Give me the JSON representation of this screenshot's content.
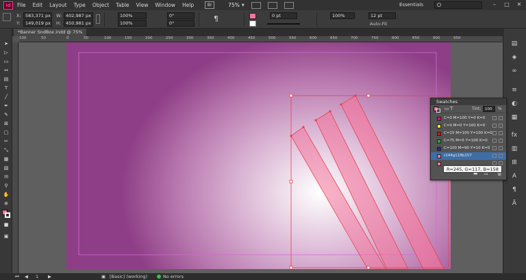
{
  "app": {
    "logo_text": "Id",
    "bridge_label": "Br",
    "zoom": "75%",
    "workspace": "Essentials"
  },
  "menu": [
    "File",
    "Edit",
    "Layout",
    "Type",
    "Object",
    "Table",
    "View",
    "Window",
    "Help"
  ],
  "control_panel": {
    "x_label": "X:",
    "x_value": "583,371 px",
    "y_label": "Y:",
    "y_value": "149,019 px",
    "w_label": "W:",
    "w_value": "402,987 px",
    "h_label": "H:",
    "h_value": "450,981 px",
    "scale_x": "100%",
    "scale_y": "100%",
    "rotate": "0°",
    "shear": "0°",
    "stroke_weight": "0 pt",
    "opacity": "100%",
    "font_size": "12 pt",
    "auto_fit": "Auto-Fit"
  },
  "document": {
    "tab_title": "*Banner SndBox.indd @ 75%"
  },
  "ruler": {
    "ticks": [
      "100",
      "50",
      "0",
      "50",
      "100",
      "150",
      "200",
      "250",
      "300",
      "350",
      "400",
      "450",
      "500",
      "550",
      "600",
      "650",
      "700",
      "750",
      "800",
      "850",
      "900",
      "950"
    ]
  },
  "swatches_panel": {
    "title": "Swatches",
    "tint_label": "Tint:",
    "tint_value": "100",
    "tint_unit": "%",
    "items": [
      {
        "name": "C=0 M=100 Y=0 K=0",
        "color": "#e6007e"
      },
      {
        "name": "C=0 M=0 Y=100 K=0",
        "color": "#ffed00"
      },
      {
        "name": "C=15 M=100 Y=100 K=0",
        "color": "#c8141a"
      },
      {
        "name": "C=75 M=5 Y=100 K=0",
        "color": "#2ea043"
      },
      {
        "name": "C=100 M=90 Y=10 K=0",
        "color": "#22307a"
      },
      {
        "name": "r244g118b157",
        "color": "#f4769d",
        "selected": true
      },
      {
        "name": "",
        "color": "#f5759e"
      }
    ],
    "tooltip": "R=245, G=117, B=158"
  },
  "status": {
    "page": "1",
    "master": "[Basic] (working)",
    "errors": "No errors"
  },
  "colors": {
    "page_edge": "#8e3e86",
    "stripe": "#f4769d",
    "selection": "#e8404a",
    "margin_guide": "#d36ad0"
  }
}
